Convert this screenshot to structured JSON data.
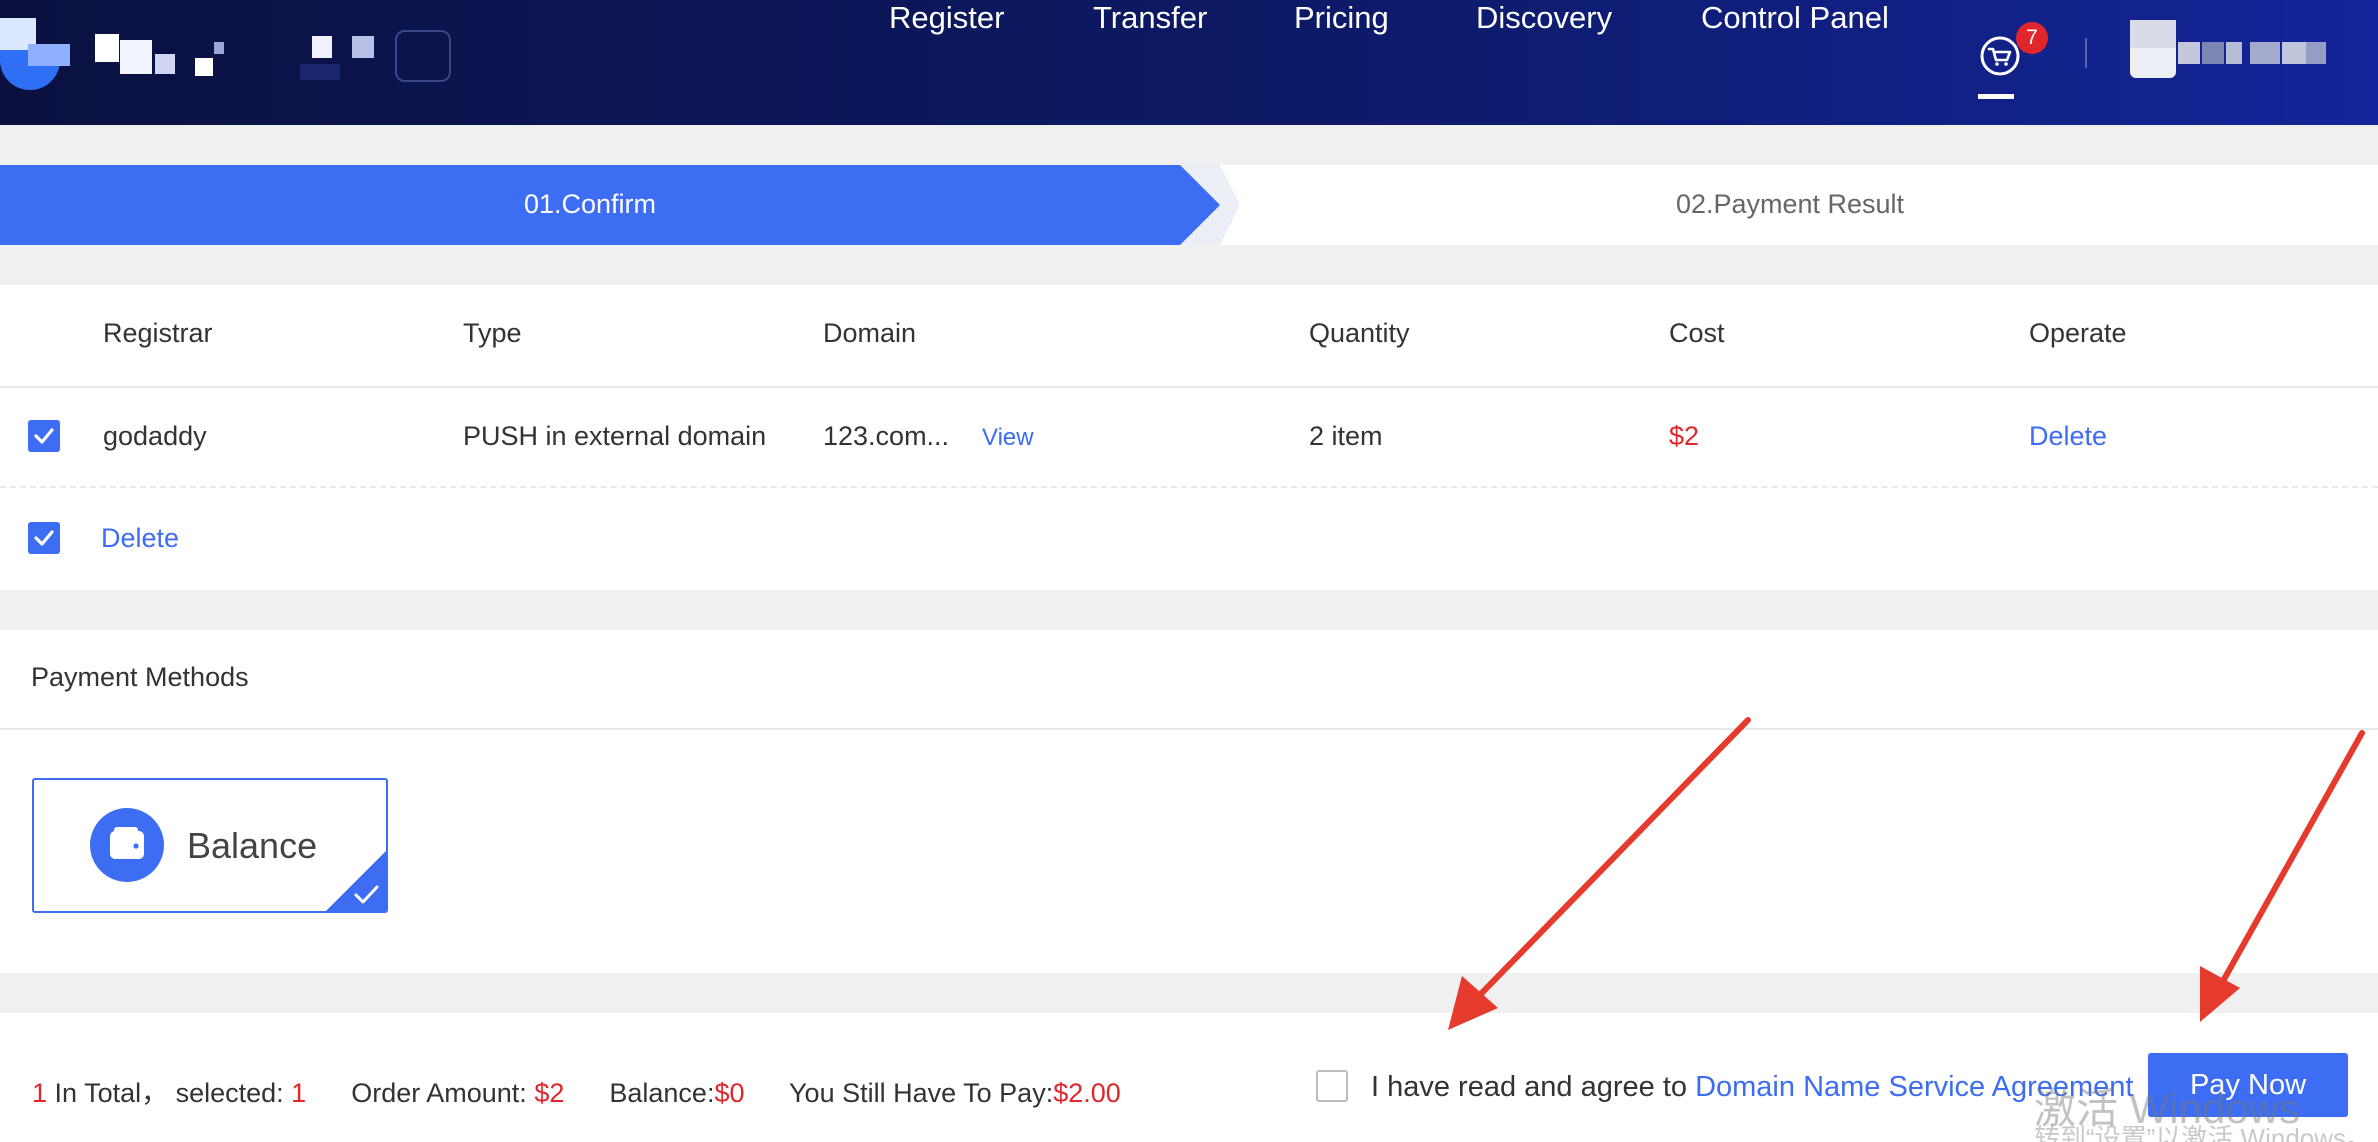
{
  "header": {
    "nav": [
      "Register",
      "Transfer",
      "Pricing",
      "Discovery",
      "Control Panel"
    ],
    "cart_icon": "shopping-cart-icon",
    "cart_count": "7"
  },
  "steps": [
    {
      "label": "01.Confirm",
      "active": true
    },
    {
      "label": "02.Payment Result",
      "active": false
    }
  ],
  "table": {
    "columns": [
      "Registrar",
      "Type",
      "Domain",
      "Quantity",
      "Cost",
      "Operate"
    ],
    "rows": [
      {
        "checked": true,
        "registrar": "godaddy",
        "type": "PUSH in external domain",
        "domain": "123.com...",
        "view": "View",
        "quantity": "2 item",
        "cost": "$2",
        "operate": "Delete"
      }
    ],
    "bulk_checked": true,
    "bulk_action": "Delete"
  },
  "payment": {
    "title": "Payment Methods",
    "method": "Balance",
    "method_icon": "wallet-icon",
    "selected": true
  },
  "footer": {
    "total_count": "1",
    "total_label": " In Total， selected: ",
    "selected_count": "1",
    "order_amount_label": "Order Amount: ",
    "order_amount": "$2",
    "balance_label": "Balance:",
    "balance": "$0",
    "still_pay_label": "You Still Have To Pay:",
    "still_pay": "$2.00",
    "agree_text": "I have read and agree to ",
    "agreement_link": "Domain Name Service Agreement",
    "agree_checked": false,
    "pay_button": "Pay Now"
  },
  "watermark": {
    "line1": "激活 Windows",
    "line2": "转到“设置”以激活 Windows。"
  },
  "colors": {
    "accent": "#3d6df2",
    "price_red": "#e0262b",
    "header_dark": "#0a1140",
    "arrow": "#e53a2c"
  }
}
